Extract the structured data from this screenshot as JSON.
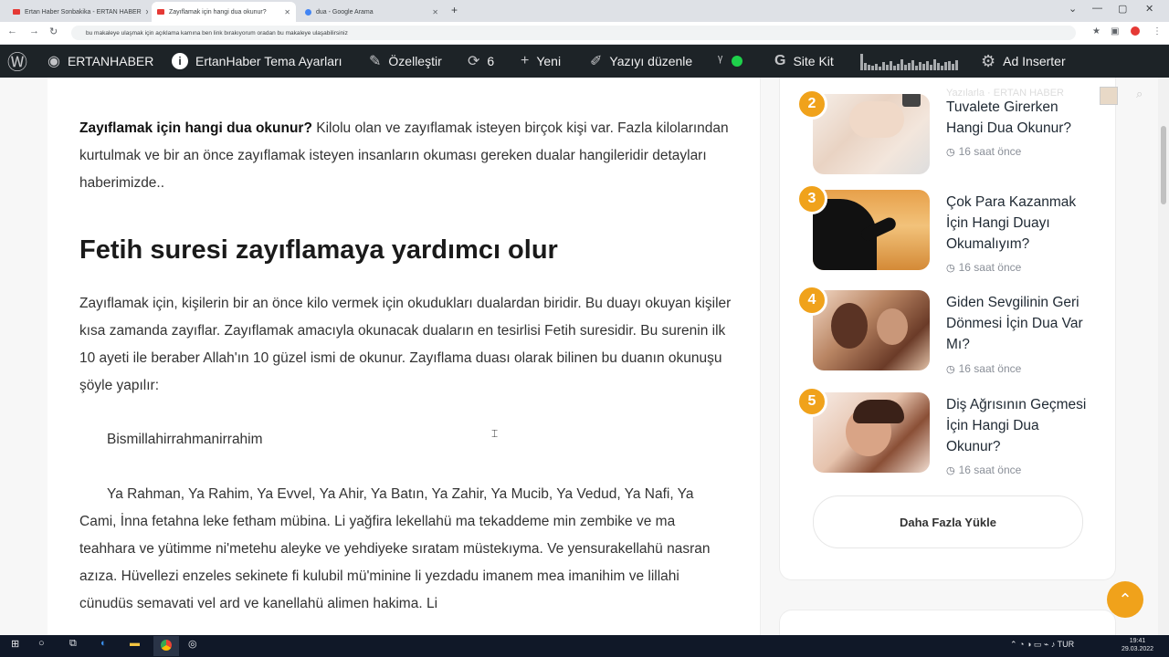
{
  "browser": {
    "tabs": [
      {
        "label": "Ertan Haber Sonbakika - ERTAN HABER",
        "active": false,
        "favicon_color": "#e53935"
      },
      {
        "label": "Zayıflamak için hangi dua okunur?",
        "active": true,
        "favicon_color": "#e53935"
      },
      {
        "label": "dua - Google Arama",
        "active": false,
        "favicon_color": "#4285f4"
      }
    ],
    "new_tab": "+",
    "url": "bu makaleye ulaşmak için açıklama kamına ben link bırakıyorum oradan bu makaleye ulaşabilirsiniz"
  },
  "admin_bar": {
    "site_name": "ERTANHABER",
    "theme_settings": "ErtanHaber Tema Ayarları",
    "customize": "Özelleştir",
    "updates_count": "6",
    "new": "Yeni",
    "edit_post": "Yazıyı düzenle",
    "site_kit": "Site Kit",
    "ad_inserter": "Ad Inserter"
  },
  "article": {
    "intro_bold": "Zayıflamak için hangi dua okunur?",
    "intro_rest": " Kilolu olan ve zayıflamak isteyen birçok kişi var. Fazla kilolarından kurtulmak ve bir an önce zayıflamak isteyen insanların okuması gereken dualar hangileridir detayları haberimizde..",
    "heading": "Fetih suresi zayıflamaya yardımcı olur",
    "para1": "Zayıflamak için, kişilerin bir an önce kilo vermek için okudukları dualardan biridir. Bu duayı okuyan kişiler kısa zamanda zayıflar. Zayıflamak amacıyla okunacak duaların en tesirlisi Fetih suresidir. Bu surenin ilk 10 ayeti ile beraber Allah'ın 10 güzel ismi de okunur. Zayıflama duası olarak bilinen bu duanın okunuşu şöyle yapılır:",
    "besmele": "Bismillahirrahmanirrahim",
    "dua": "Ya Rahman, Ya Rahim, Ya Evvel, Ya Ahir, Ya Batın, Ya Zahir, Ya Mucib, Ya Vedud, Ya Nafi, Ya Cami, İnna fetahna leke fetham mübina. Li yağfira lekellahü ma tekaddeme min zembike ve ma teahhara ve yütimme ni'metehu aleyke ve yehdiyeke sıratam müstekıyma. Ve yensurakellahü nasran azıza. Hüvellezi enzeles sekinete fi kulubil mü'minine li yezdadu imanem mea imanihim ve lillahi cünudüs semavati vel ard ve kanellahü alimen hakima. Li"
  },
  "sidebar": {
    "faded_header": "Yazılarla · ERTAN HABER",
    "items": [
      {
        "rank": "2",
        "title": "Tuvalete Girerken Hangi Dua Okunur?",
        "time": "16 saat önce"
      },
      {
        "rank": "3",
        "title": "Çok Para Kazanmak İçin Hangi Duayı Okumalıyım?",
        "time": "16 saat önce"
      },
      {
        "rank": "4",
        "title": "Giden Sevgilinin Geri Dönmesi İçin Dua Var Mı?",
        "time": "16 saat önce"
      },
      {
        "rank": "5",
        "title": "Diş Ağrısının Geçmesi İçin Hangi Dua Okunur?",
        "time": "16 saat önce"
      }
    ],
    "load_more": "Daha Fazla Yükle"
  },
  "taskbar": {
    "time": "19:41",
    "date": "29.03.2022"
  },
  "colors": {
    "accent": "#f0a21b",
    "admin_bar": "#1d2327",
    "taskbar": "#101828"
  }
}
